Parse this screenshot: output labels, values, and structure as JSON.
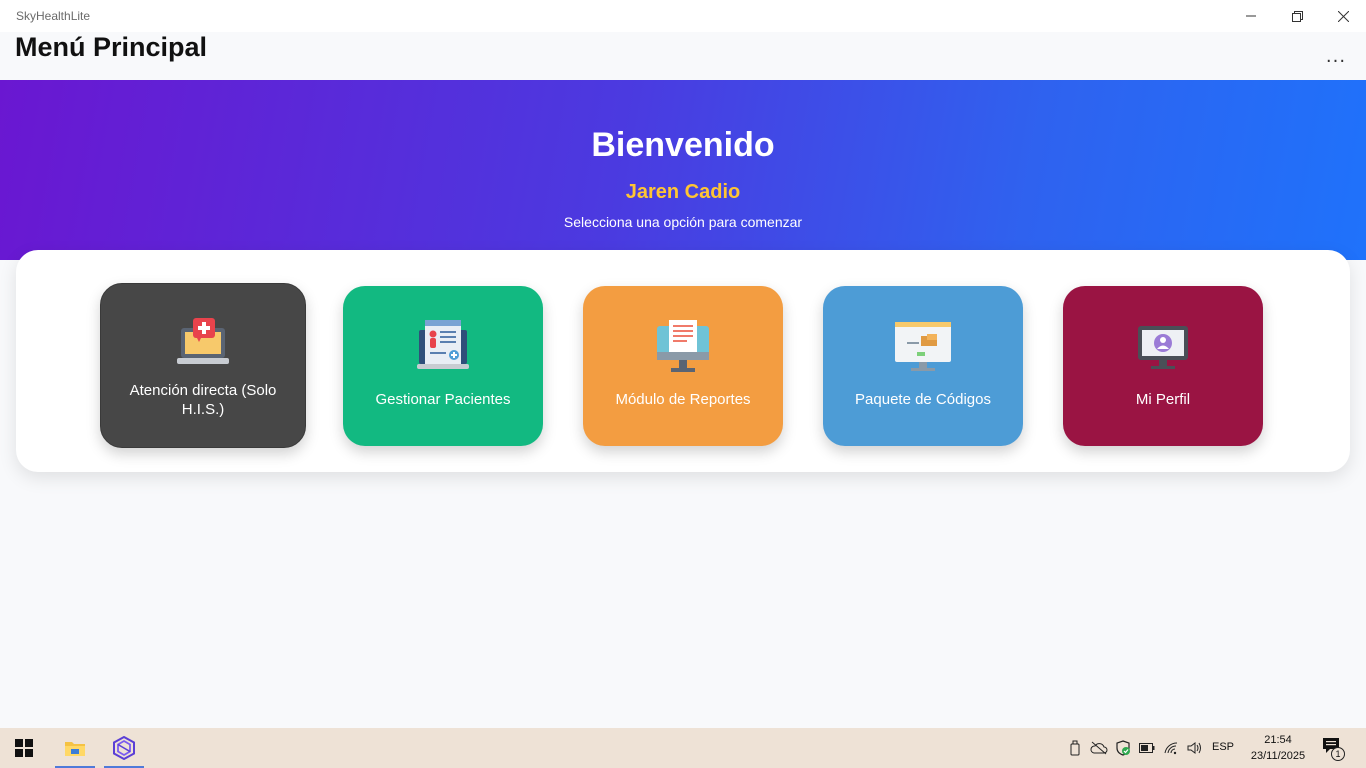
{
  "window": {
    "title": "SkyHealthLite"
  },
  "header": {
    "title": "Menú Principal",
    "more_label": "..."
  },
  "hero": {
    "title": "Bienvenido",
    "user_name": "Jaren Cadio",
    "subtitle": "Selecciona una opción para comenzar"
  },
  "cards": [
    {
      "label": "Atención directa (Solo H.I.S.)",
      "color": "#474747",
      "icon": "laptop-medical-icon"
    },
    {
      "label": "Gestionar Pacientes",
      "color": "#12b981",
      "icon": "patient-record-icon"
    },
    {
      "label": "Módulo de Reportes",
      "color": "#f39d41",
      "icon": "report-monitor-icon"
    },
    {
      "label": "Paquete de Códigos",
      "color": "#4d9cd6",
      "icon": "code-package-monitor-icon"
    },
    {
      "label": "Mi Perfil",
      "color": "#9a1443",
      "icon": "profile-monitor-icon"
    }
  ],
  "taskbar": {
    "language": "ESP",
    "time": "21:54",
    "date": "23/11/2025",
    "notification_count": "1"
  },
  "colors": {
    "hero_start": "#6a17d1",
    "hero_end": "#1f72fb",
    "user_name": "#ffc533"
  }
}
